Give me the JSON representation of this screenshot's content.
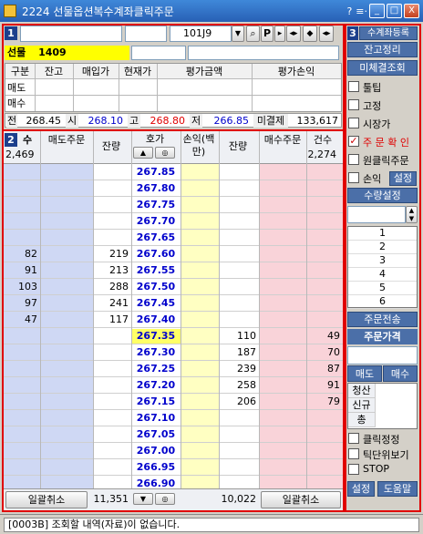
{
  "window": {
    "title": "2224 선물옵션복수계좌클릭주문",
    "minimize": "_",
    "restore": "□",
    "close": "X",
    "icon_menu": "?",
    "icon_list": "≡·"
  },
  "panel1": {
    "badge": "1",
    "account_input": "",
    "account_name": "",
    "code": "101J9",
    "product_label": "선물",
    "product_code": "1409"
  },
  "balance_table": {
    "headers": [
      "구분",
      "잔고",
      "매입가",
      "현재가",
      "평가금액",
      "평가손익"
    ],
    "rows": [
      [
        "매도",
        "",
        "",
        "",
        "",
        ""
      ],
      [
        "매수",
        "",
        "",
        "",
        "",
        ""
      ]
    ]
  },
  "quote_row": {
    "label_now": "전",
    "prev": "268.45",
    "label_open": "시",
    "open": "268.10",
    "label_high": "고",
    "high": "268.80",
    "label_low": "저",
    "low": "266.85",
    "label_oi": "미결제",
    "oi": "133,617"
  },
  "panel2": {
    "badge": "2",
    "headers": {
      "count_sell": "수",
      "sell_order": "매도주문",
      "sell_qty": "잔량",
      "price": "호가",
      "pnl": "손익(백만)",
      "buy_qty": "잔량",
      "buy_order": "매수주문",
      "count_buy": "건수"
    },
    "sell_count_total": "2,469",
    "buy_count_total": "2,274",
    "rows": [
      {
        "cnt_s": "",
        "qty_s": "",
        "price": "267.85",
        "qty_b": "",
        "cnt_b": ""
      },
      {
        "cnt_s": "",
        "qty_s": "",
        "price": "267.80",
        "qty_b": "",
        "cnt_b": ""
      },
      {
        "cnt_s": "",
        "qty_s": "",
        "price": "267.75",
        "qty_b": "",
        "cnt_b": ""
      },
      {
        "cnt_s": "",
        "qty_s": "",
        "price": "267.70",
        "qty_b": "",
        "cnt_b": ""
      },
      {
        "cnt_s": "",
        "qty_s": "",
        "price": "267.65",
        "qty_b": "",
        "cnt_b": ""
      },
      {
        "cnt_s": "82",
        "qty_s": "219",
        "price": "267.60",
        "qty_b": "",
        "cnt_b": ""
      },
      {
        "cnt_s": "91",
        "qty_s": "213",
        "price": "267.55",
        "qty_b": "",
        "cnt_b": ""
      },
      {
        "cnt_s": "103",
        "qty_s": "288",
        "price": "267.50",
        "qty_b": "",
        "cnt_b": ""
      },
      {
        "cnt_s": "97",
        "qty_s": "241",
        "price": "267.45",
        "qty_b": "",
        "cnt_b": ""
      },
      {
        "cnt_s": "47",
        "qty_s": "117",
        "price": "267.40",
        "qty_b": "",
        "cnt_b": ""
      },
      {
        "cnt_s": "",
        "qty_s": "",
        "price": "267.35",
        "qty_b": "110",
        "cnt_b": "49"
      },
      {
        "cnt_s": "",
        "qty_s": "",
        "price": "267.30",
        "qty_b": "187",
        "cnt_b": "70"
      },
      {
        "cnt_s": "",
        "qty_s": "",
        "price": "267.25",
        "qty_b": "239",
        "cnt_b": "87"
      },
      {
        "cnt_s": "",
        "qty_s": "",
        "price": "267.20",
        "qty_b": "258",
        "cnt_b": "91"
      },
      {
        "cnt_s": "",
        "qty_s": "",
        "price": "267.15",
        "qty_b": "206",
        "cnt_b": "79"
      },
      {
        "cnt_s": "",
        "qty_s": "",
        "price": "267.10",
        "qty_b": "",
        "cnt_b": ""
      },
      {
        "cnt_s": "",
        "qty_s": "",
        "price": "267.05",
        "qty_b": "",
        "cnt_b": ""
      },
      {
        "cnt_s": "",
        "qty_s": "",
        "price": "267.00",
        "qty_b": "",
        "cnt_b": ""
      },
      {
        "cnt_s": "",
        "qty_s": "",
        "price": "266.95",
        "qty_b": "",
        "cnt_b": ""
      },
      {
        "cnt_s": "",
        "qty_s": "",
        "price": "266.90",
        "qty_b": "",
        "cnt_b": ""
      }
    ],
    "current_price": "267.35",
    "sell_total": "11,351",
    "buy_total": "10,022",
    "cancel_all_left": "일괄취소",
    "cancel_all_right": "일괄취소"
  },
  "panel3": {
    "badge": "3",
    "register": "수계좌등록",
    "balance_clear": "잔고정리",
    "unfilled": "미체결조회",
    "checks": [
      {
        "label": "툴팁",
        "checked": false
      },
      {
        "label": "고정",
        "checked": false
      },
      {
        "label": "시장가",
        "checked": false
      },
      {
        "label": "주 문 확 인",
        "checked": true
      },
      {
        "label": "원클릭주문",
        "checked": false
      },
      {
        "label": "손익",
        "checked": false
      }
    ],
    "setting": "설정",
    "qty_setting": "수량설정",
    "qty_list": [
      "1",
      "2",
      "3",
      "4",
      "5",
      "6"
    ],
    "order_send": "주문전송",
    "order_price": "주문가격",
    "sell": "매도",
    "buy": "매수",
    "kinds": [
      "청산",
      "신규",
      "총"
    ],
    "checks2": [
      {
        "label": "클릭정정"
      },
      {
        "label": "틱단위보기"
      },
      {
        "label": "STOP"
      }
    ],
    "setting2": "설정",
    "help": "도움말"
  },
  "status": {
    "message": "[0003B] 조회할 내역(자료)이 없습니다."
  },
  "colors": {
    "sell_bg": "#cfd8f4",
    "buy_bg": "#f9d3d9",
    "price_bg": "#ffffff",
    "current_bg": "#ffff66",
    "pnl_bg": "#ffffc2",
    "price_text": "#0000cc",
    "title_blue": "#2860b5"
  }
}
